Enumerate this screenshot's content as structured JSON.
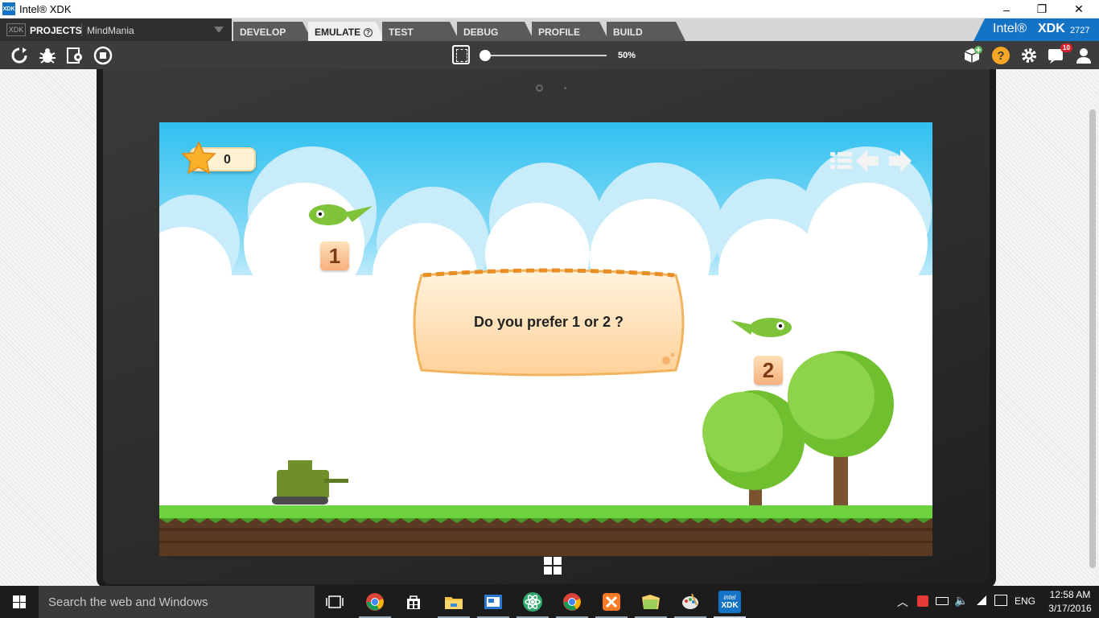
{
  "window": {
    "title": "Intel® XDK",
    "app_icon": "XDK",
    "minimize": "–",
    "maximize": "❐",
    "close": "✕"
  },
  "tabbar": {
    "xdk_badge": "XDK",
    "projects_label": "PROJECTS",
    "project_name": "MindMania",
    "tabs": [
      {
        "label": "DEVELOP"
      },
      {
        "label": "EMULATE",
        "active": true
      },
      {
        "label": "TEST"
      },
      {
        "label": "DEBUG"
      },
      {
        "label": "PROFILE"
      },
      {
        "label": "BUILD"
      }
    ],
    "brand": {
      "intel": "Intel®",
      "xdk": "XDK",
      "version": "2727"
    }
  },
  "toolbar": {
    "zoom_label": "50%",
    "zoom_level": 0.5,
    "notifications_count": "10",
    "icons": [
      "reload-icon",
      "bug-icon",
      "debug-settings-icon",
      "stop-icon",
      "zoom-fit-icon",
      "cube-add-icon",
      "help-icon",
      "settings-icon",
      "notifications-icon",
      "user-icon"
    ]
  },
  "game": {
    "score": "0",
    "question": "Do you prefer 1 or 2 ?",
    "option_1": "1",
    "option_2": "2",
    "icons": [
      "menu-icon",
      "back-arrow-icon",
      "forward-arrow-icon"
    ],
    "colors": {
      "sky": "#2fc0ef",
      "grass": "#6fd33f",
      "dirt": "#5a3a22",
      "tree": "#8ccf3f",
      "star": "#f9b12b"
    }
  },
  "taskbar": {
    "search_placeholder": "Search the web and Windows",
    "apps": [
      "task-view-icon",
      "chrome-icon",
      "store-icon",
      "file-explorer-icon",
      "slides-icon",
      "atom-icon",
      "chrome-icon",
      "xampp-icon",
      "folder-icon",
      "paint-icon",
      "intel-xdk-icon"
    ],
    "xdk_app_label_1": "intel",
    "xdk_app_label_2": "XDK",
    "language": "ENG",
    "time": "12:58 AM",
    "date": "3/17/2016"
  }
}
